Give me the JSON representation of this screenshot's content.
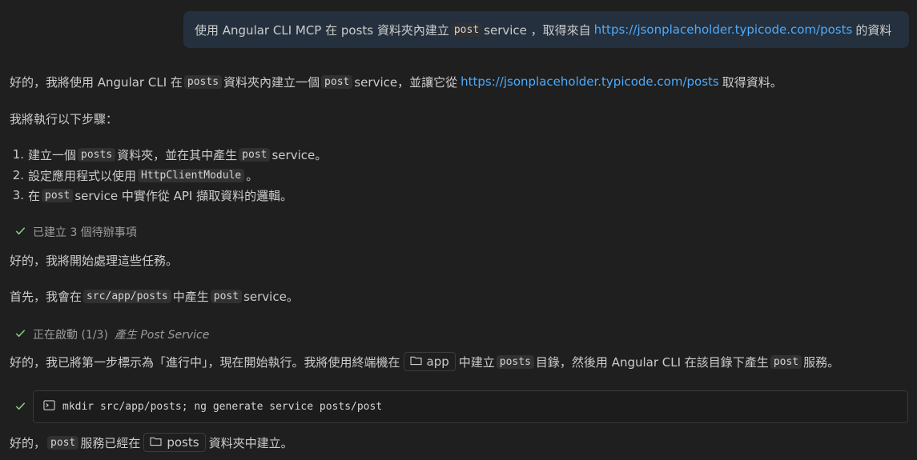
{
  "user_message": {
    "part1": "使用 Angular CLI MCP 在 posts 資料夾內建立",
    "code": "post",
    "part2": "service ，取得來自",
    "link": "https://jsonplaceholder.typicode.com/posts",
    "part3": "的資料"
  },
  "response": {
    "intro": {
      "t1": "好的，我將使用 Angular CLI 在",
      "code1": "posts",
      "t2": "資料夾內建立一個",
      "code2": "post",
      "t3": "service，並讓它從",
      "link": "https://jsonplaceholder.typicode.com/posts",
      "t4": "取得資料。"
    },
    "steps_heading": "我將執行以下步驟：",
    "steps": [
      {
        "num": "1.",
        "t1": "建立一個",
        "code": "posts",
        "t2": "資料夾，並在其中產生",
        "code2": "post",
        "t3": "service。"
      },
      {
        "num": "2.",
        "t1": "設定應用程式以使用",
        "code": "HttpClientModule",
        "t2": "。"
      },
      {
        "num": "3.",
        "t1": "在",
        "code": "post",
        "t2": "service 中實作從 API 擷取資料的邏輯。"
      }
    ],
    "status_todos": "已建立 3 個待辦事項",
    "start_tasks": "好的，我將開始處理這些任務。",
    "first": {
      "t1": "首先，我會在",
      "code1": "src/app/posts",
      "t2": "中產生",
      "code2": "post",
      "t3": "service。"
    },
    "status_starting": {
      "prefix": "正在啟動 (1/3)",
      "task": "產生 Post Service"
    },
    "marked": {
      "t1": "好的，我已將第一步標示為「進行中」，現在開始執行。我將使用終端機在",
      "chip": "app",
      "t2": "中建立",
      "code1": "posts",
      "t3": "目錄，然後用 Angular CLI 在該目錄下產生",
      "code2": "post",
      "t4": "服務。"
    },
    "terminal_command": "mkdir src/app/posts; ng generate service posts/post",
    "done": {
      "t1": "好的，",
      "code": "post",
      "t2": "服務已經在",
      "chip": "posts",
      "t3": "資料夾中建立。"
    }
  },
  "colors": {
    "background": "#1f1f1f",
    "user_bubble": "#24303d",
    "link": "#4daafc",
    "check": "#89d185",
    "code_bg": "#313131"
  },
  "icons": [
    "check-icon",
    "folder-icon",
    "terminal-icon"
  ]
}
